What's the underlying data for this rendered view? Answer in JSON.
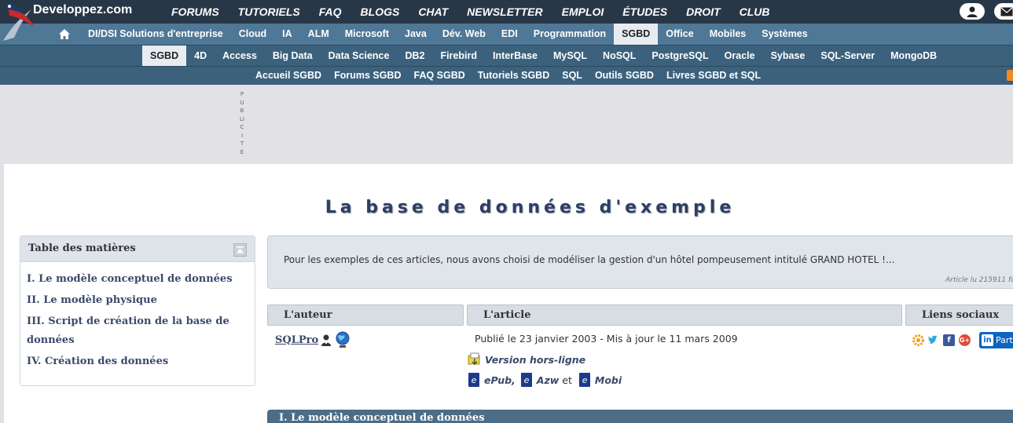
{
  "logo": {
    "text": "Developpez.com"
  },
  "topnav": [
    "FORUMS",
    "TUTORIELS",
    "FAQ",
    "BLOGS",
    "CHAT",
    "NEWSLETTER",
    "EMPLOI",
    "ÉTUDES",
    "DROIT",
    "CLUB"
  ],
  "nav2": {
    "items": [
      "DI/DSI Solutions d'entreprise",
      "Cloud",
      "IA",
      "ALM",
      "Microsoft",
      "Java",
      "Dév. Web",
      "EDI",
      "Programmation",
      "SGBD",
      "Office",
      "Mobiles",
      "Systèmes"
    ],
    "active": "SGBD"
  },
  "nav3": {
    "items": [
      "SGBD",
      "4D",
      "Access",
      "Big Data",
      "Data Science",
      "DB2",
      "Firebird",
      "InterBase",
      "MySQL",
      "NoSQL",
      "PostgreSQL",
      "Oracle",
      "Sybase",
      "SQL-Server",
      "MongoDB"
    ],
    "active": "SGBD"
  },
  "nav4": {
    "items": [
      "Accueil SGBD",
      "Forums SGBD",
      "FAQ SGBD",
      "Tutoriels SGBD",
      "SQL",
      "Outils SGBD",
      "Livres SGBD et SQL"
    ]
  },
  "ad": {
    "label": "PUBLICITÉ"
  },
  "page": {
    "title": "La base de données d'exemple"
  },
  "toc": {
    "title": "Table des matières",
    "items": [
      "I. Le modèle conceptuel de données",
      "II. Le modèle physique",
      "III. Script de création de la base de données",
      "IV. Création des données"
    ]
  },
  "abstract": {
    "text": "Pour les exemples de ces articles, nous avons choisi de modéliser la gestion d'un hôtel pompeusement intitulé GRAND HOTEL !...",
    "stat": "Article lu 215911 fo"
  },
  "columns": {
    "author": "L'auteur",
    "article": "L'article",
    "social": "Liens sociaux"
  },
  "author": {
    "name": "SQLPro"
  },
  "article": {
    "dates": "Publié le 23 janvier 2003 - Mis à jour le 11 mars 2009",
    "offline": "Version hors-ligne",
    "epub": "ePub,",
    "azw": "Azw",
    "et": "et",
    "mobi": "Mobi"
  },
  "social": {
    "linkedin_label": "Part"
  },
  "section1": {
    "title": "I. Le modèle conceptuel de données"
  },
  "colors": {
    "topbar": "#283747",
    "nav2": "#4f7796",
    "nav3": "#3b617d",
    "title": "#2e3e66"
  }
}
